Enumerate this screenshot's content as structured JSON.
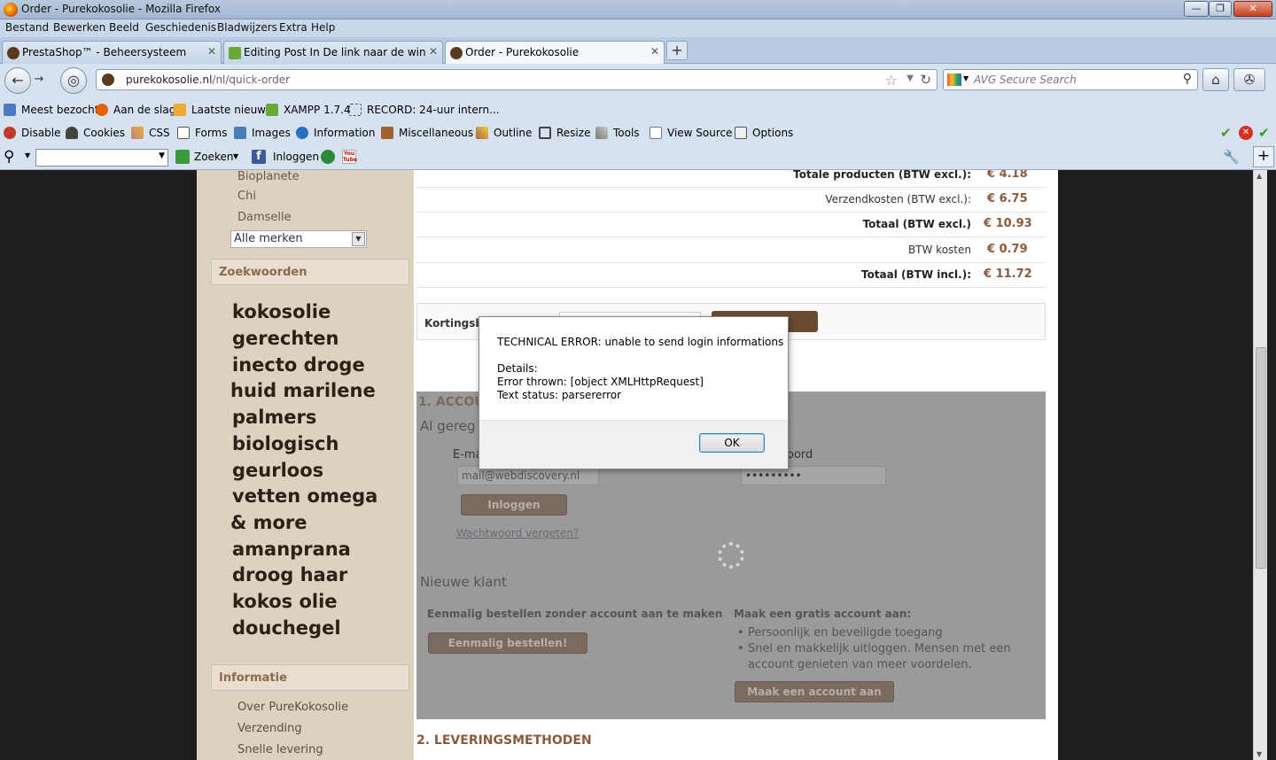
{
  "window": {
    "title": "Order - Purekokosolie - Mozilla Firefox",
    "controls": {
      "minimize": "—",
      "maximize": "❐",
      "close": "✕"
    }
  },
  "menubar": [
    "Bestand",
    "Bewerken",
    "Beeld",
    "Geschiedenis",
    "Bladwijzers",
    "Extra",
    "Help"
  ],
  "tabs": [
    {
      "label": "PrestaShop™ - Beheersysteem"
    },
    {
      "label": "Editing Post In De link naar de winkel..."
    },
    {
      "label": "Order - Purekokosolie"
    }
  ],
  "newtab": "+",
  "navbar": {
    "back": "←",
    "forward": "→",
    "url_domain": "purekokosolie.nl",
    "url_path": "/nl/quick-order",
    "search_placeholder": "AVG Secure Search",
    "star": "☆",
    "reload": "↻",
    "home": "⌂"
  },
  "bookmarks": [
    "Meest bezocht",
    "Aan de slag",
    "Laatste nieuws",
    "XAMPP 1.7.4",
    "RECORD: 24-uur intern..."
  ],
  "webdev": [
    "Disable",
    "Cookies",
    "CSS",
    "Forms",
    "Images",
    "Information",
    "Miscellaneous",
    "Outline",
    "Resize",
    "Tools",
    "View Source",
    "Options"
  ],
  "searchtool": {
    "zoeken": "Zoeken",
    "inloggen": "Inloggen",
    "youtube": "You Tube"
  },
  "sidebar": {
    "brands": [
      "Bioplanete",
      "Chi",
      "Damselle"
    ],
    "brand_select": "Alle merken",
    "keywords_title": "Zoekwoorden",
    "keywords": [
      "kokosolie",
      "gerechten",
      "inecto droge",
      "huid marilene",
      "palmers",
      "biologisch",
      "geurloos",
      "vetten omega",
      "& more",
      "amanprana",
      "droog haar",
      "kokos olie",
      "douchegel"
    ],
    "info_title": "Informatie",
    "info_links": [
      "Over PureKokosolie",
      "Verzending",
      "Snelle levering"
    ]
  },
  "summary": [
    {
      "label": "Totale producten (BTW excl.):",
      "value": "€ 4.18",
      "bold": true
    },
    {
      "label": "Verzendkosten (BTW excl.):",
      "value": "€ 6.75",
      "bold": false
    },
    {
      "label": "Totaal (BTW excl.)",
      "value": "€ 10.93",
      "bold": true
    },
    {
      "label": "BTW kosten",
      "value": "€ 0.79",
      "bold": false
    },
    {
      "label": "Totaal (BTW incl.):",
      "value": "€ 11.72",
      "bold": true
    }
  ],
  "coupon": {
    "label": "Kortingsb"
  },
  "account": {
    "heading": "1. ACCOU",
    "already": "Al gereg",
    "email_label": "E-ma",
    "email_value": "mail@webdiscovery.nl",
    "password_label": "oord",
    "password_value": "•••••••••",
    "login_button": "Inloggen",
    "forgot": "Wachtwoord vergeten?",
    "new_customer": "Nieuwe klant",
    "guest_heading": "Eenmalig bestellen zonder account aan te maken",
    "guest_button": "Eenmalig bestellen!",
    "create_heading": "Maak een gratis account aan:",
    "benefits": [
      "Persoonlijk en beveiligde toegang",
      "Snel en makkelijk uitloggen. Mensen met een account genieten van meer voordelen."
    ],
    "create_button": "Maak een account aan"
  },
  "shipping_heading": "2. LEVERINGSMETHODEN",
  "dialog": {
    "line1": "TECHNICAL ERROR: unable to send login informations",
    "line2": "Details:",
    "line3": "Error thrown: [object XMLHttpRequest]",
    "line4": "Text status: parsererror",
    "ok": "OK"
  }
}
